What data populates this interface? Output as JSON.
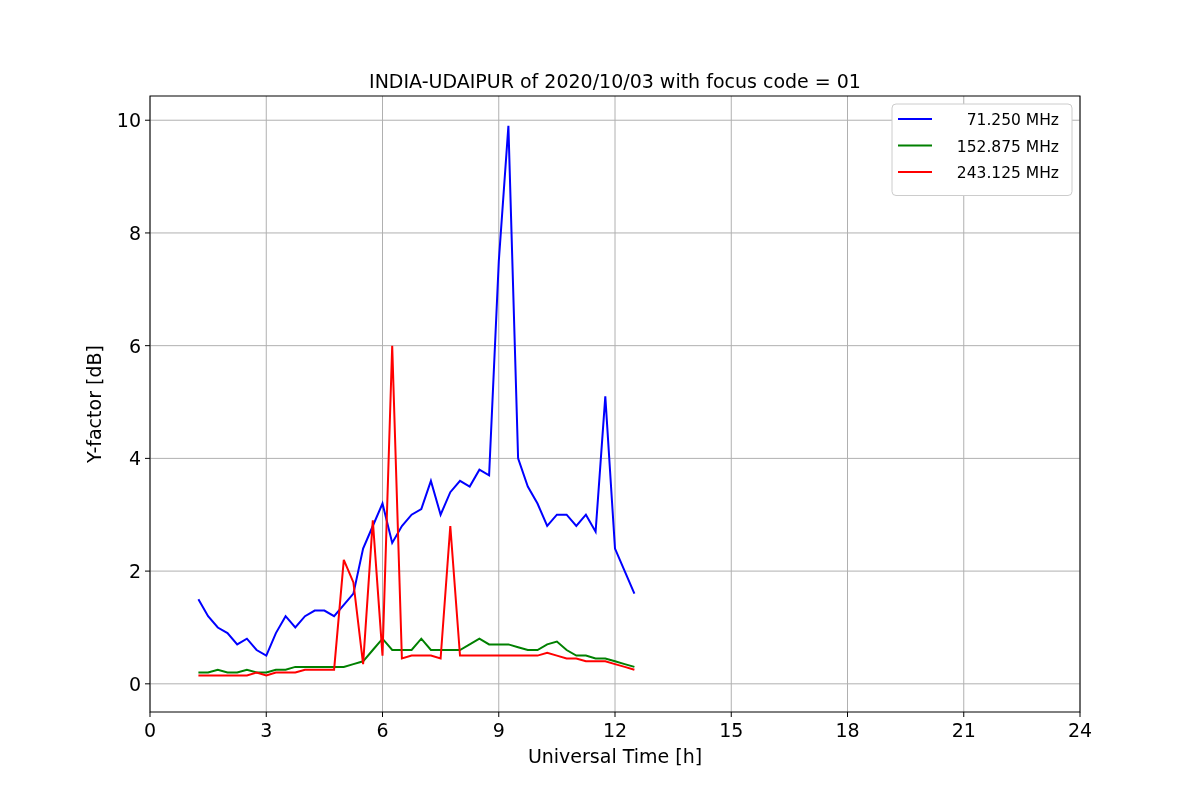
{
  "figure": {
    "chart_data": {
      "type": "line",
      "title": "INDIA-UDAIPUR of 2020/10/03 with focus code = 01",
      "xlabel": "Universal Time [h]",
      "ylabel": "Y-factor [dB]",
      "x": [
        1.25,
        1.5,
        1.75,
        2.0,
        2.25,
        2.5,
        2.75,
        3.0,
        3.25,
        3.5,
        3.75,
        4.0,
        4.25,
        4.5,
        4.75,
        5.0,
        5.25,
        5.5,
        5.75,
        6.0,
        6.25,
        6.5,
        6.75,
        7.0,
        7.25,
        7.5,
        7.75,
        8.0,
        8.25,
        8.5,
        8.75,
        9.0,
        9.25,
        9.5,
        9.75,
        10.0,
        10.25,
        10.5,
        10.75,
        11.0,
        11.25,
        11.5,
        11.75,
        12.0,
        12.25,
        12.5
      ],
      "series": [
        {
          "name": "71.250 MHz",
          "color": "#0000ff",
          "values": [
            1.5,
            1.2,
            1.0,
            0.9,
            0.7,
            0.8,
            0.6,
            0.5,
            0.9,
            1.2,
            1.0,
            1.2,
            1.3,
            1.3,
            1.2,
            1.4,
            1.6,
            2.4,
            2.8,
            3.2,
            2.5,
            2.8,
            3.0,
            3.1,
            3.6,
            3.0,
            3.4,
            3.6,
            3.5,
            3.8,
            3.7,
            7.5,
            9.9,
            4.0,
            3.5,
            3.2,
            2.8,
            3.0,
            3.0,
            2.8,
            3.0,
            2.7,
            5.1,
            2.4,
            2.0,
            1.6
          ]
        },
        {
          "name": "152.875 MHz",
          "color": "#008000",
          "values": [
            0.2,
            0.2,
            0.25,
            0.2,
            0.2,
            0.25,
            0.2,
            0.2,
            0.25,
            0.25,
            0.3,
            0.3,
            0.3,
            0.3,
            0.3,
            0.3,
            0.35,
            0.4,
            0.6,
            0.8,
            0.6,
            0.6,
            0.6,
            0.8,
            0.6,
            0.6,
            0.6,
            0.6,
            0.7,
            0.8,
            0.7,
            0.7,
            0.7,
            0.65,
            0.6,
            0.6,
            0.7,
            0.75,
            0.6,
            0.5,
            0.5,
            0.45,
            0.45,
            0.4,
            0.35,
            0.3
          ]
        },
        {
          "name": "243.125 MHz",
          "color": "#ff0000",
          "values": [
            0.15,
            0.15,
            0.15,
            0.15,
            0.15,
            0.15,
            0.2,
            0.15,
            0.2,
            0.2,
            0.2,
            0.25,
            0.25,
            0.25,
            0.25,
            2.2,
            1.8,
            0.35,
            2.9,
            0.5,
            6.0,
            0.45,
            0.5,
            0.5,
            0.5,
            0.45,
            2.8,
            0.5,
            0.5,
            0.5,
            0.5,
            0.5,
            0.5,
            0.5,
            0.5,
            0.5,
            0.55,
            0.5,
            0.45,
            0.45,
            0.4,
            0.4,
            0.4,
            0.35,
            0.3,
            0.25
          ]
        }
      ],
      "grid": true,
      "legend": true,
      "xlim": [
        0,
        24
      ],
      "ylim": [
        -0.5,
        10.43
      ],
      "xticks": [
        0,
        3,
        6,
        9,
        12,
        15,
        18,
        21,
        24
      ],
      "yticks": [
        0,
        2,
        4,
        6,
        8,
        10
      ]
    }
  }
}
